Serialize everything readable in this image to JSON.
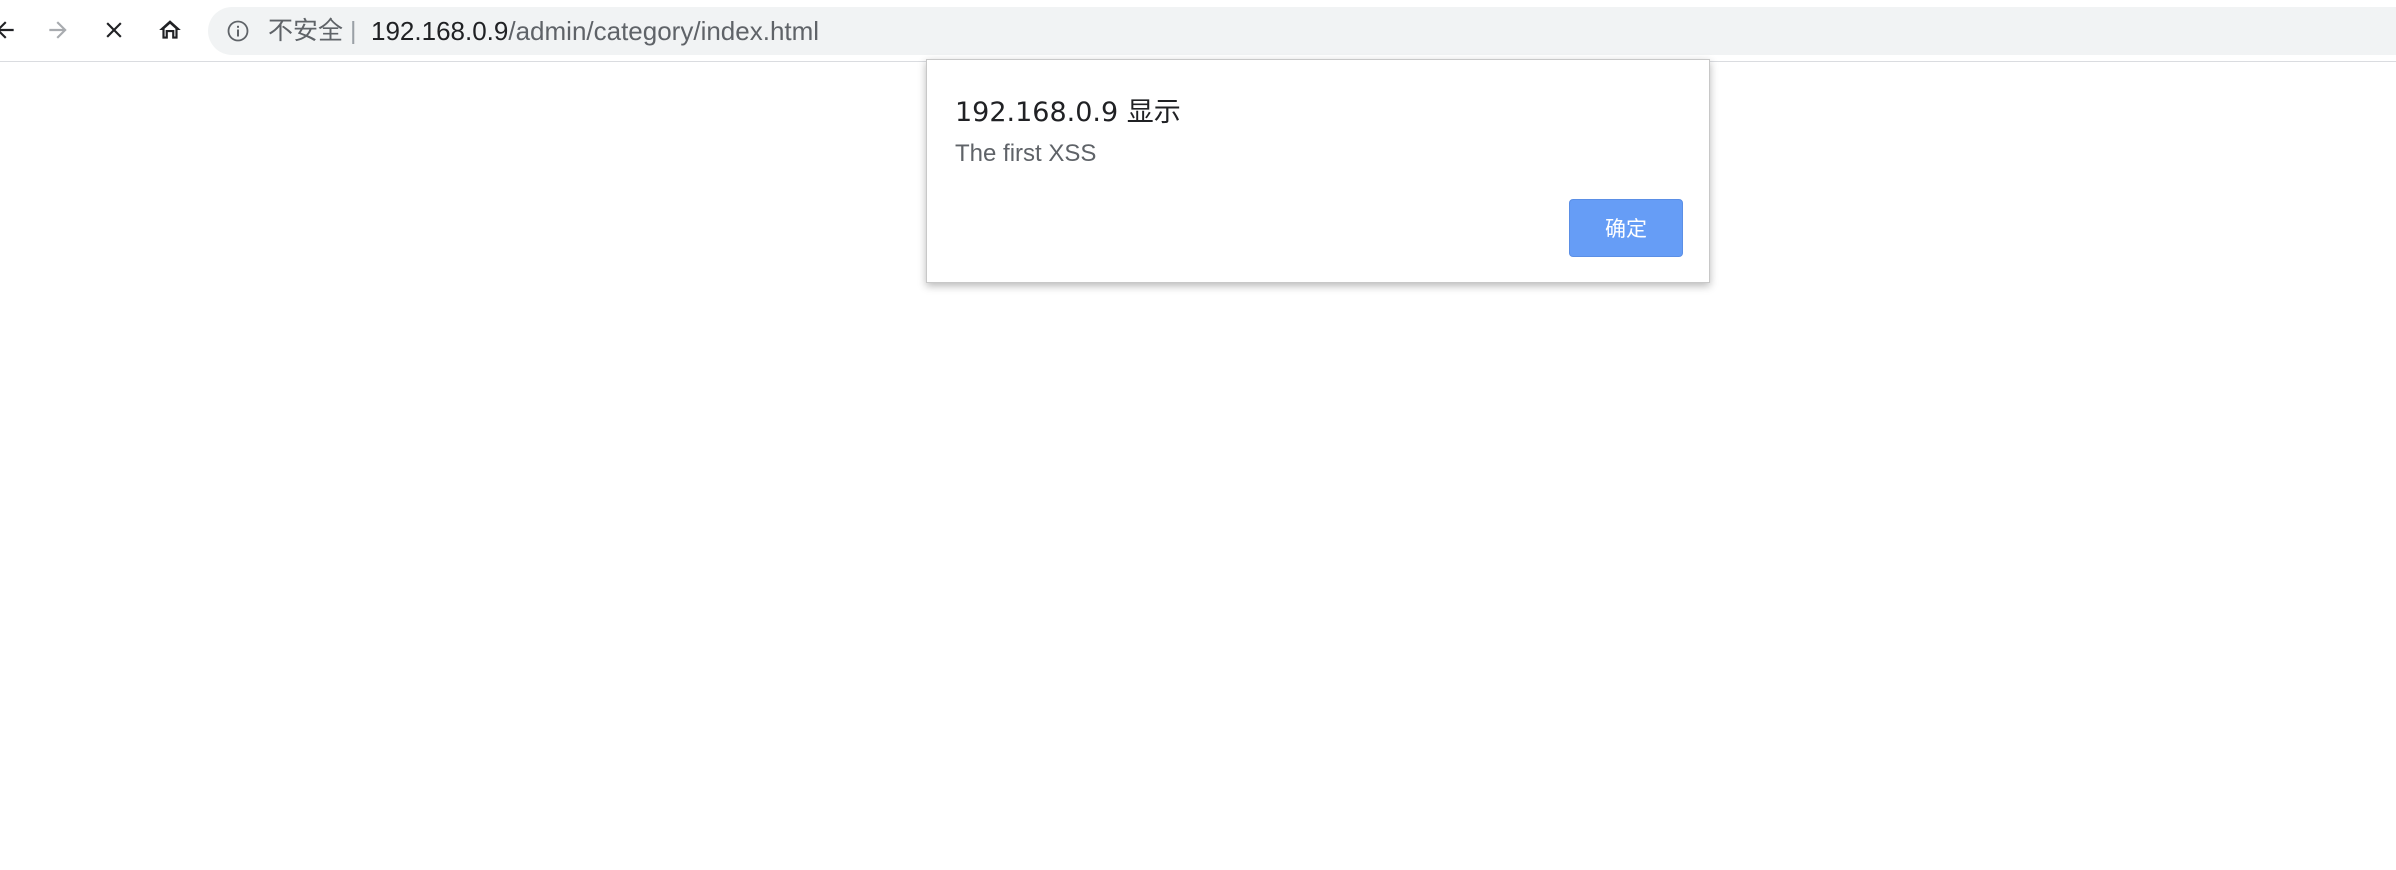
{
  "toolbar": {
    "back_icon": "arrow-left-icon",
    "forward_icon": "arrow-right-icon",
    "stop_icon": "close-icon",
    "home_icon": "home-icon"
  },
  "omnibox": {
    "info_icon": "info-icon",
    "security_label": "不安全",
    "separator": "|",
    "url_host": "192.168.0.9",
    "url_path": "/admin/category/index.html"
  },
  "dialog": {
    "title": "192.168.0.9 显示",
    "message": "The first XSS",
    "ok_label": "确定"
  },
  "colors": {
    "button_bg": "#669df6",
    "omnibox_bg": "#f1f3f4"
  }
}
